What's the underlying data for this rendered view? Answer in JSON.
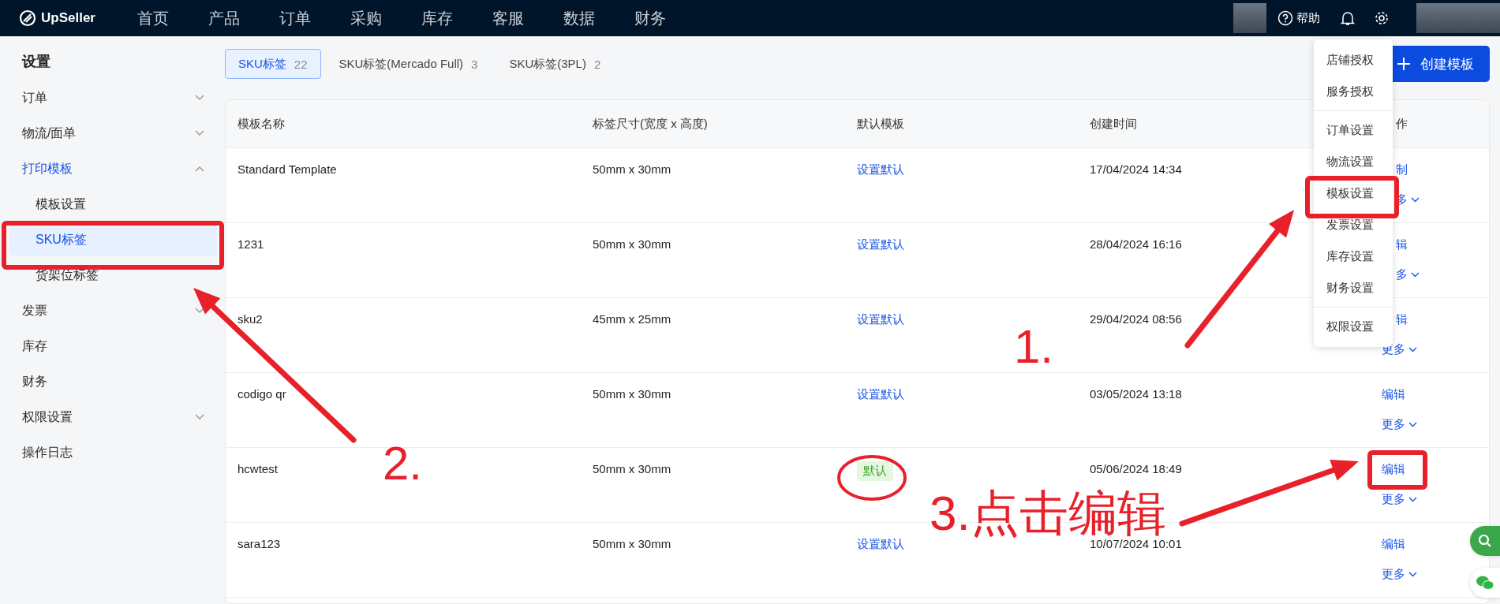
{
  "topbar": {
    "logo": "UpSeller",
    "nav": [
      "首页",
      "产品",
      "订单",
      "采购",
      "库存",
      "客服",
      "数据",
      "财务"
    ],
    "help": "帮助"
  },
  "sidebar": {
    "title": "设置",
    "items": [
      {
        "label": "订单",
        "kind": "group",
        "expanded": false,
        "selected": false
      },
      {
        "label": "物流/面单",
        "kind": "group",
        "expanded": false,
        "selected": false
      },
      {
        "label": "打印模板",
        "kind": "group",
        "expanded": true,
        "selected": false,
        "children": [
          {
            "label": "模板设置",
            "selected": false
          },
          {
            "label": "SKU标签",
            "selected": true
          },
          {
            "label": "货架位标签",
            "selected": false
          }
        ]
      },
      {
        "label": "发票",
        "kind": "group",
        "expanded": false,
        "selected": false
      },
      {
        "label": "库存",
        "kind": "link",
        "selected": false
      },
      {
        "label": "财务",
        "kind": "link",
        "selected": false
      },
      {
        "label": "权限设置",
        "kind": "group",
        "expanded": false,
        "selected": false
      },
      {
        "label": "操作日志",
        "kind": "link",
        "selected": false
      }
    ]
  },
  "tabs": [
    {
      "label": "SKU标签",
      "count": "22",
      "selected": true
    },
    {
      "label": "SKU标签(Mercado Full)",
      "count": "3",
      "selected": false
    },
    {
      "label": "SKU标签(3PL)",
      "count": "2",
      "selected": false
    }
  ],
  "create_button": "创建模板",
  "table": {
    "columns": [
      "模板名称",
      "标签尺寸(宽度 x 高度)",
      "默认模板",
      "创建时间",
      "作"
    ],
    "rows": [
      {
        "name": "Standard Template",
        "size": "50mm x 30mm",
        "default": {
          "kind": "link",
          "text": "设置默认"
        },
        "created": "17/04/2024 14:34",
        "actions": [
          "制",
          "多"
        ]
      },
      {
        "name": "1231",
        "size": "50mm x 30mm",
        "default": {
          "kind": "link",
          "text": "设置默认"
        },
        "created": "28/04/2024 16:16",
        "actions": [
          "辑",
          "多"
        ]
      },
      {
        "name": "sku2",
        "size": "45mm x 25mm",
        "default": {
          "kind": "link",
          "text": "设置默认"
        },
        "created": "29/04/2024 08:56",
        "actions": [
          "辑",
          "更多"
        ]
      },
      {
        "name": "codigo qr",
        "size": "50mm x 30mm",
        "default": {
          "kind": "link",
          "text": "设置默认"
        },
        "created": "03/05/2024 13:18",
        "actions": [
          "编辑",
          "更多"
        ]
      },
      {
        "name": "hcwtest",
        "size": "50mm x 30mm",
        "default": {
          "kind": "tag",
          "text": "默认"
        },
        "created": "05/06/2024 18:49",
        "actions": [
          "编辑",
          "更多"
        ]
      },
      {
        "name": "sara123",
        "size": "50mm x 30mm",
        "default": {
          "kind": "link",
          "text": "设置默认"
        },
        "created": "10/07/2024 10:01",
        "actions": [
          "编辑",
          "更多"
        ]
      }
    ]
  },
  "settings_menu": {
    "groups": [
      [
        "店铺授权",
        "服务授权"
      ],
      [
        "订单设置",
        "物流设置",
        "模板设置",
        "发票设置",
        "库存设置",
        "财务设置"
      ],
      [
        "权限设置"
      ]
    ]
  },
  "annotations": [
    "1.",
    "2.",
    "3.点击编辑"
  ]
}
